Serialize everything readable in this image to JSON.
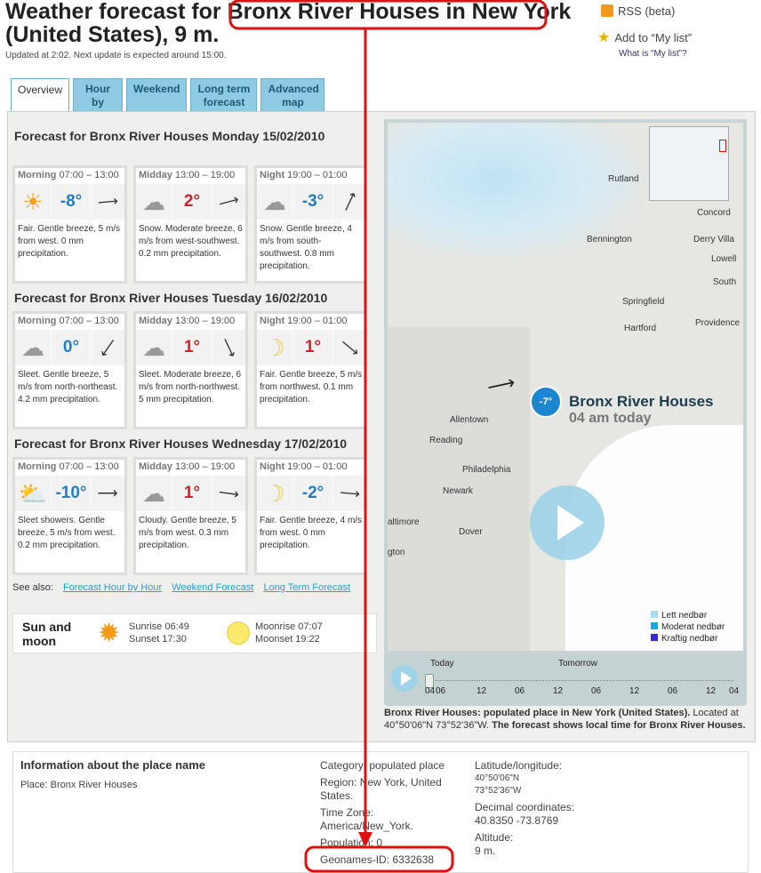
{
  "header": {
    "title": "Weather forecast for Bronx River Houses in New York (United States), 9 m.",
    "updated": "Updated at 2:02. Next update is expected around 15:00.",
    "rss": "RSS (beta)",
    "add_list": "Add to “My list”",
    "what_is": "What is “My list”?"
  },
  "tabs": [
    {
      "label": "Overview"
    },
    {
      "label": "Hour by hour"
    },
    {
      "label": "Weekend"
    },
    {
      "label": "Long term forecast"
    },
    {
      "label": "Advanced map"
    }
  ],
  "days": [
    {
      "heading": "Forecast for Bronx River Houses Monday 15/02/2010",
      "periods": [
        {
          "name": "Morning",
          "time": "07:00 – 13:00",
          "icon": "sun",
          "temp": "-8°",
          "cold": true,
          "wind": "⟶",
          "rot": -5,
          "desc": "Fair. Gentle breeze, 5 m/s from west. 0 mm precipitation."
        },
        {
          "name": "Midday",
          "time": "13:00 – 19:00",
          "icon": "snow",
          "temp": "2°",
          "cold": false,
          "wind": "⟶",
          "rot": -15,
          "desc": "Snow. Moderate breeze, 6 m/s from west-southwest. 0.2 mm precipitation."
        },
        {
          "name": "Night",
          "time": "19:00 – 01:00",
          "icon": "snow",
          "temp": "-3°",
          "cold": true,
          "wind": "⟶",
          "rot": -65,
          "desc": "Snow. Gentle breeze, 4 m/s from south-southwest. 0.8 mm precipitation."
        }
      ]
    },
    {
      "heading": "Forecast for Bronx River Houses Tuesday 16/02/2010",
      "periods": [
        {
          "name": "Morning",
          "time": "07:00 – 13:00",
          "icon": "sleet",
          "temp": "0°",
          "cold": true,
          "wind": "⟶",
          "rot": 125,
          "desc": "Sleet. Gentle breeze, 5 m/s from north-northeast. 4.2 mm precipitation."
        },
        {
          "name": "Midday",
          "time": "13:00 – 19:00",
          "icon": "sleet",
          "temp": "1°",
          "cold": false,
          "wind": "⟶",
          "rot": 65,
          "desc": "Sleet. Moderate breeze, 6 m/s from north-northwest. 5 mm precipitation."
        },
        {
          "name": "Night",
          "time": "19:00 – 01:00",
          "icon": "moon",
          "temp": "1°",
          "cold": false,
          "wind": "⟶",
          "rot": 40,
          "desc": "Fair. Gentle breeze, 5 m/s from northwest. 0.1 mm precipitation."
        }
      ]
    },
    {
      "heading": "Forecast for Bronx River Houses Wednesday 17/02/2010",
      "periods": [
        {
          "name": "Morning",
          "time": "07:00 – 13:00",
          "icon": "sleetshowers",
          "temp": "-10°",
          "cold": true,
          "wind": "⟶",
          "rot": 0,
          "desc": "Sleet showers. Gentle breeze, 5 m/s from west. 0.2 mm precipitation."
        },
        {
          "name": "Midday",
          "time": "13:00 – 19:00",
          "icon": "cloud",
          "temp": "1°",
          "cold": false,
          "wind": "⟶",
          "rot": 8,
          "desc": "Cloudy. Gentle breeze, 5 m/s from west. 0.3 mm precipitation."
        },
        {
          "name": "Night",
          "time": "19:00 – 01:00",
          "icon": "moon-cloud",
          "temp": "-2°",
          "cold": true,
          "wind": "⟶",
          "rot": 5,
          "desc": "Fair. Gentle breeze, 4 m/s from west. 0 mm precipitation."
        }
      ]
    }
  ],
  "see_also": {
    "label": "See also:",
    "links": [
      "Forecast Hour by Hour",
      "Weekend Forecast",
      "Long Term Forecast"
    ]
  },
  "sun_moon": {
    "title": "Sun and moon",
    "sunrise": "Sunrise 06:49",
    "sunset": "Sunset 17:30",
    "moonrise": "Moonrise 07:07",
    "moonset": "Moonset 19:22"
  },
  "map": {
    "place": "Bronx River Houses",
    "time": "04 am today",
    "marker_temp": "-7°",
    "labels": [
      "Rutland",
      "Concord",
      "Bennington",
      "Derry Villa",
      "Lowell",
      "South",
      "Springfield",
      "Hartford",
      "Providence",
      "Allentown",
      "Reading",
      "Philadelphia",
      "Newark",
      "Dover",
      "altimore",
      "gton"
    ],
    "legend": [
      {
        "label": "Lett nedbør",
        "color": "#a8dcf3"
      },
      {
        "label": "Moderat nedbør",
        "color": "#1aa5d8"
      },
      {
        "label": "Kraftig nedbør",
        "color": "#3a2bd0"
      }
    ],
    "timeline": {
      "today": "Today",
      "tomorrow": "Tomorrow",
      "ticks": [
        "04",
        "06",
        "12",
        "06",
        "12",
        "06",
        "12",
        "06",
        "12",
        "04"
      ]
    }
  },
  "caption": {
    "bold1": "Bronx River Houses: populated place in New York (United States).",
    "normal": " Located at 40°50'06\"N 73°52'36\"W.",
    "bold2": " The forecast shows local time for Bronx River Houses."
  },
  "info": {
    "title": "Information about the place name",
    "place": "Place: Bronx River Houses",
    "category": "Category: populated place",
    "region": "Region: New York, United States.",
    "timezone": "Time Zone: America/New_York.",
    "population": "Population: 0",
    "geonames": "Geonames-ID: 6332638",
    "latlon_label": "Latitude/longitude:",
    "lat": "40°50'06\"N",
    "lon": "73°52'36\"W",
    "decimal_label": "Decimal coordinates:",
    "decimal": "40.8350 -73.8769",
    "altitude_label": "Altitude:",
    "altitude": "9 m."
  },
  "colors": {
    "annotation": "#e01010",
    "tab": "#8ecbe3",
    "cold": "#1e7fc2",
    "warm": "#d1202b"
  }
}
